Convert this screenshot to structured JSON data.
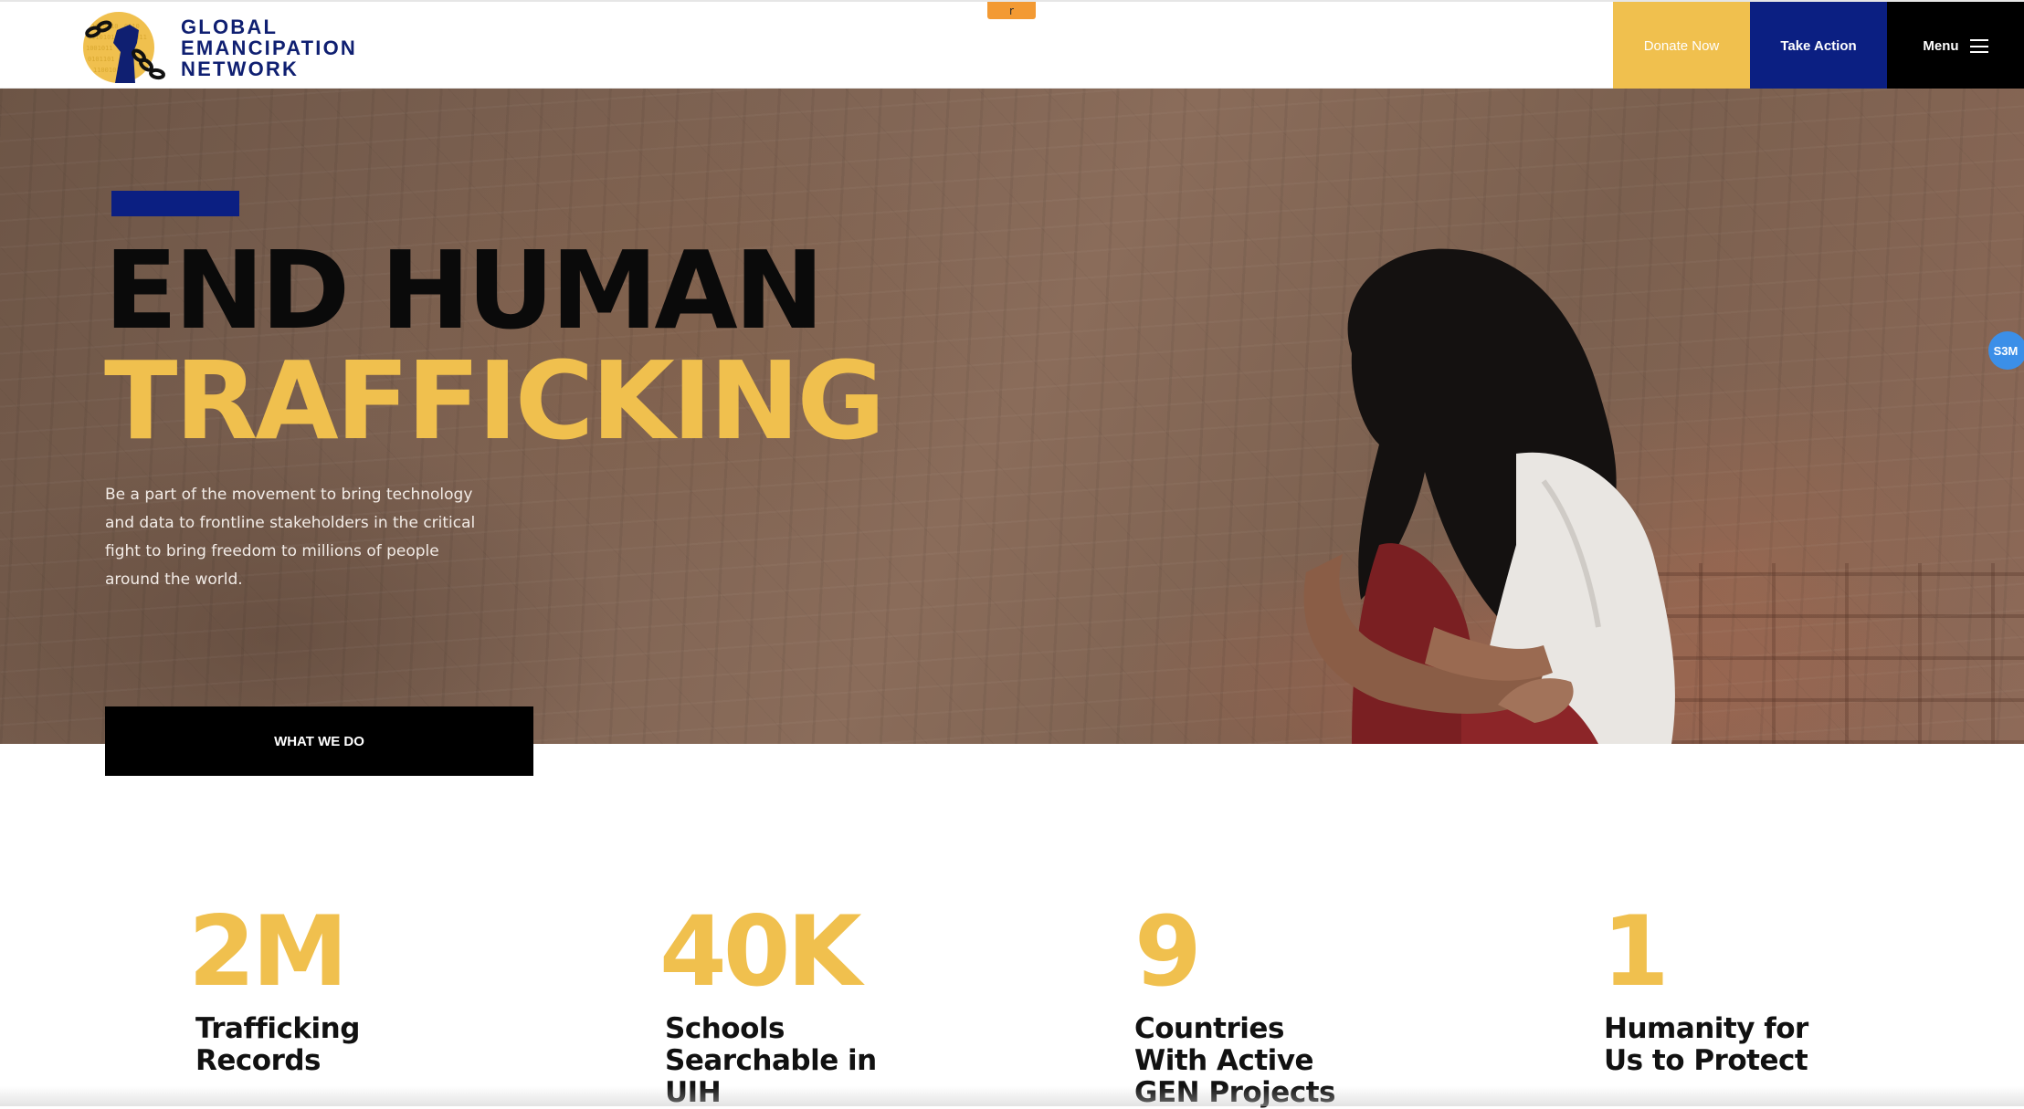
{
  "header": {
    "logo_lines": [
      "GLOBAL",
      "EMANCIPATION",
      "NETWORK"
    ],
    "top_tab": "r",
    "donate_label": "Donate Now",
    "action_label": "Take Action",
    "menu_label": "Menu"
  },
  "hero": {
    "title_line_1": "END HUMAN",
    "title_line_2": "TRAFFICKING",
    "description": "Be a part of the movement to bring technology and data to frontline stakeholders in the critical fight to bring freedom to millions of people around the world.",
    "cta_label": "WHAT WE DO"
  },
  "side_badge": "S3M",
  "stats": [
    {
      "value": "2M",
      "label": "Trafficking\nRecords"
    },
    {
      "value": "40K",
      "label": "Schools\nSearchable in\nUIH"
    },
    {
      "value": "9",
      "label": "Countries\nWith Active\nGEN Projects"
    },
    {
      "value": "1",
      "label": "Humanity for\nUs to Protect"
    }
  ],
  "colors": {
    "brand_navy": "#0b1f82",
    "brand_gold": "#f0c04e",
    "black": "#000000"
  }
}
